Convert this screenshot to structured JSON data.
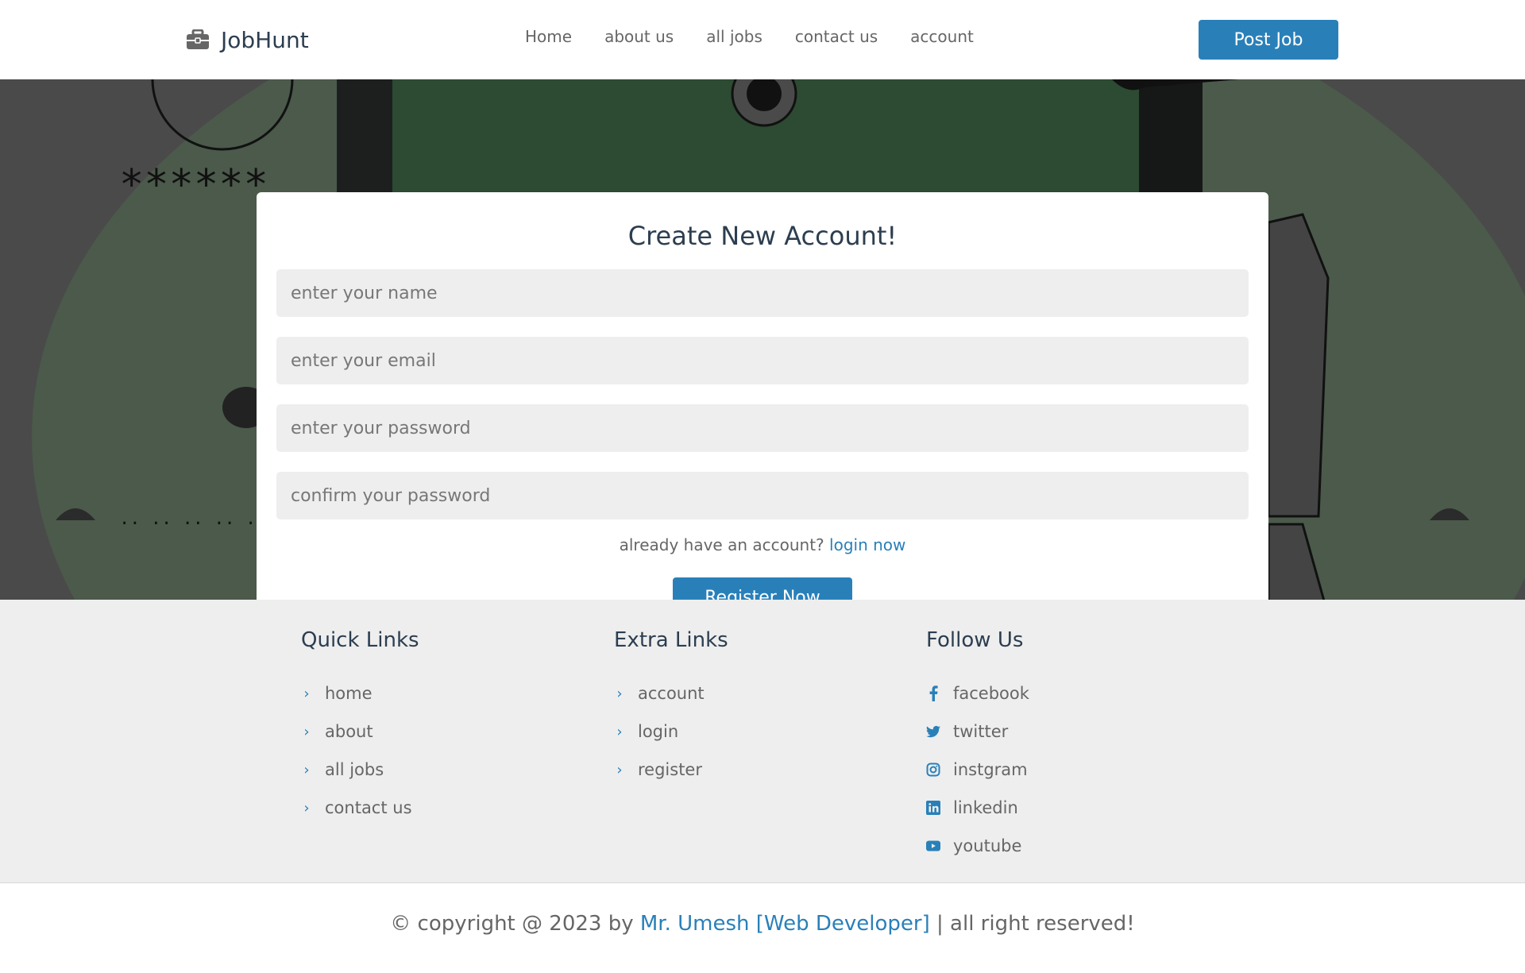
{
  "header": {
    "brand": "JobHunt",
    "nav": [
      "Home",
      "about us",
      "all jobs",
      "contact us",
      "account"
    ],
    "post_job": "Post Job"
  },
  "form": {
    "title": "Create New Account!",
    "name_placeholder": "enter your name",
    "email_placeholder": "enter your email",
    "password_placeholder": "enter your password",
    "confirm_placeholder": "confirm your password",
    "login_prompt": "already have an account?",
    "login_link": "login now",
    "register_button": "Register Now"
  },
  "footer": {
    "quick_links": {
      "title": "Quick Links",
      "items": [
        "home",
        "about",
        "all jobs",
        "contact us"
      ]
    },
    "extra_links": {
      "title": "Extra Links",
      "items": [
        "account",
        "login",
        "register"
      ]
    },
    "follow_us": {
      "title": "Follow Us",
      "items": [
        {
          "label": "facebook",
          "icon": "facebook-icon"
        },
        {
          "label": "twitter",
          "icon": "twitter-icon"
        },
        {
          "label": "instgram",
          "icon": "instagram-icon"
        },
        {
          "label": "linkedin",
          "icon": "linkedin-icon"
        },
        {
          "label": "youtube",
          "icon": "youtube-icon"
        }
      ]
    },
    "copyright_prefix": "© copyright @ 2023 by",
    "copyright_author": "Mr. Umesh [Web Developer]",
    "copyright_suffix": "| all right reserved!"
  },
  "colors": {
    "accent": "#2980b9",
    "heading": "#2c3e50",
    "overlay": "#4a4a4a",
    "footer_bg": "#eeeeee"
  }
}
